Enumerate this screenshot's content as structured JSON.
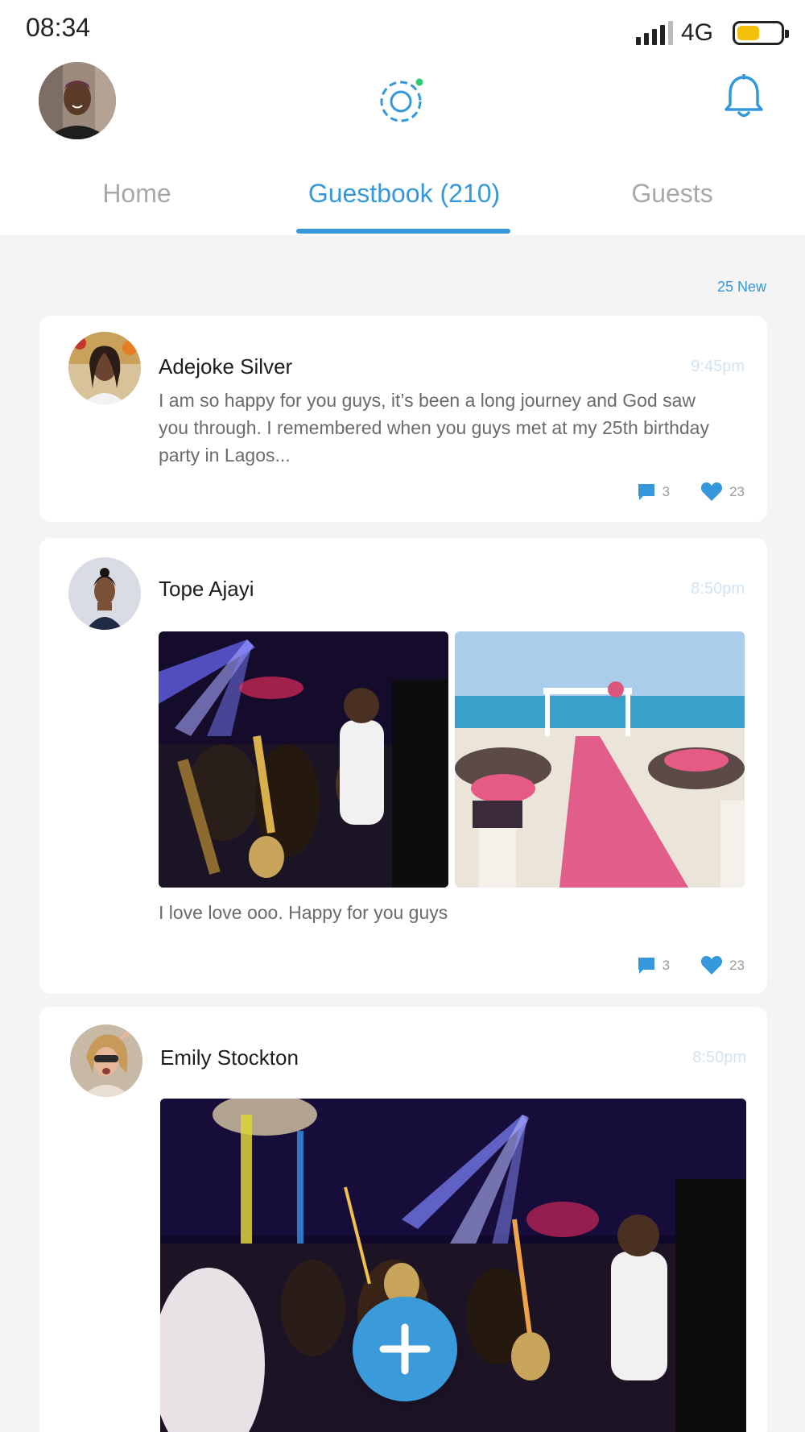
{
  "status_bar": {
    "time": "08:34",
    "network": "4G"
  },
  "tabs": [
    {
      "label": "Home"
    },
    {
      "label": "Guestbook (210)"
    },
    {
      "label": "Guests"
    }
  ],
  "new_count": "25 New",
  "posts": [
    {
      "name": "Adejoke Silver",
      "time": "9:45pm",
      "text": "I am so happy for you guys, it’s been a long journey and God saw you through. I remembered when you guys met at my 25th birthday party in Lagos...",
      "comments": "3",
      "likes": "23"
    },
    {
      "name": "Tope Ajayi",
      "time": "8:50pm",
      "text": "I love love ooo. Happy for you guys",
      "comments": "3",
      "likes": "23"
    },
    {
      "name": "Emily Stockton",
      "time": "8:50pm"
    }
  ],
  "icons": {
    "header_logo": "spark-circle-icon",
    "notifications": "bell-icon",
    "comment": "comment-icon",
    "like": "heart-icon",
    "add": "plus-icon"
  },
  "colors": {
    "accent": "#3498db",
    "battery": "#f4c20d",
    "time_label": "#d2e4f2",
    "background": "#f4f4f5"
  }
}
